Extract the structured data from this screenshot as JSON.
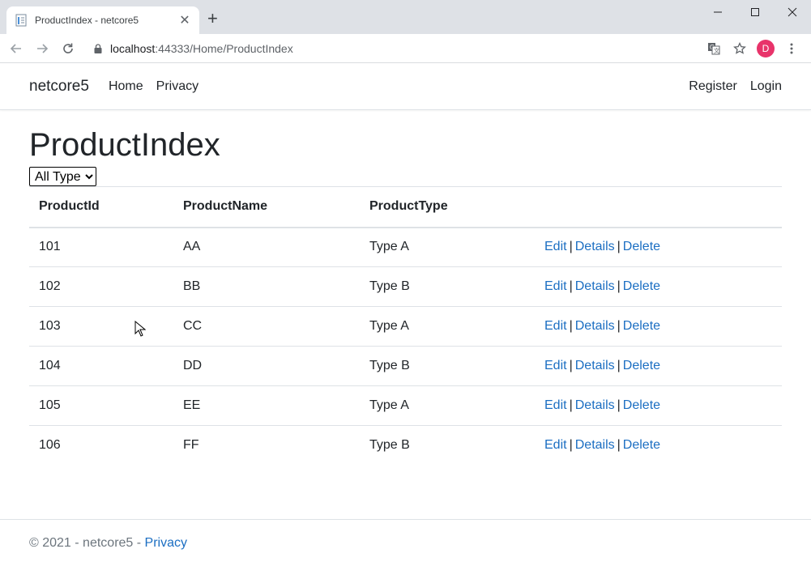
{
  "browser": {
    "tab_title": "ProductIndex - netcore5",
    "url_host": "localhost",
    "url_rest": ":44333/Home/ProductIndex",
    "profile_initial": "D",
    "profile_color": "#e8336a"
  },
  "navbar": {
    "brand": "netcore5",
    "links": [
      "Home",
      "Privacy"
    ],
    "right_links": [
      "Register",
      "Login"
    ]
  },
  "page": {
    "title": "ProductIndex",
    "filter": {
      "selected": "All Type"
    },
    "table": {
      "headers": [
        "ProductId",
        "ProductName",
        "ProductType",
        ""
      ],
      "rows": [
        {
          "id": "101",
          "name": "AA",
          "type": "Type A"
        },
        {
          "id": "102",
          "name": "BB",
          "type": "Type B"
        },
        {
          "id": "103",
          "name": "CC",
          "type": "Type A"
        },
        {
          "id": "104",
          "name": "DD",
          "type": "Type B"
        },
        {
          "id": "105",
          "name": "EE",
          "type": "Type A"
        },
        {
          "id": "106",
          "name": "FF",
          "type": "Type B"
        }
      ],
      "actions": {
        "edit": "Edit",
        "details": "Details",
        "delete": "Delete",
        "separator": "|"
      }
    }
  },
  "footer": {
    "text": "© 2021 - netcore5 - ",
    "privacy_link": "Privacy"
  },
  "colors": {
    "link": "#1b6ec2",
    "text": "#212529"
  }
}
